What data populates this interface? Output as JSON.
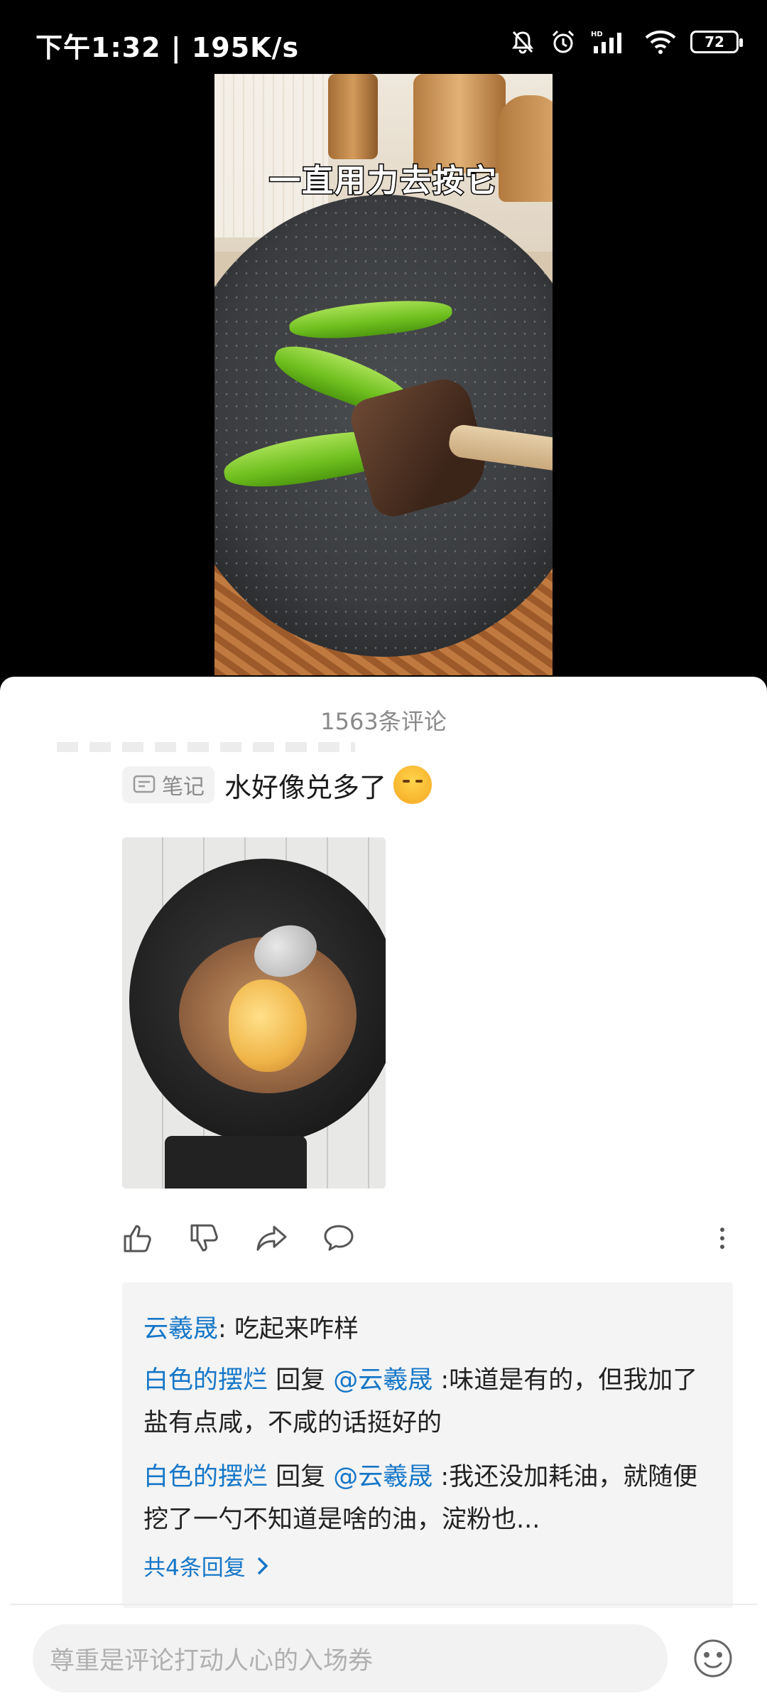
{
  "status_bar": {
    "time_speed": "下午1:32 | 195K/s",
    "battery": "72",
    "icons": [
      "mute-bell-icon",
      "alarm-icon",
      "hd-signal-icon",
      "wifi-icon",
      "battery-icon"
    ]
  },
  "video": {
    "caption": "一直用力去按它"
  },
  "comments": {
    "count_title": "1563条评论",
    "comment": {
      "note_tag": "笔记",
      "text": "水好像兑多了",
      "emoji": "blush-emoji"
    },
    "replies": [
      {
        "user": "云羲晟",
        "sep": ": ",
        "text": "吃起来咋样"
      },
      {
        "user": "白色的摆烂",
        "reply_word": " 回复 ",
        "target": "@云羲晟",
        "text": " :味道是有的，但我加了盐有点咸，不咸的话挺好的"
      },
      {
        "user": "白色的摆烂",
        "reply_word": " 回复 ",
        "target": "@云羲晟",
        "text": " :我还没加耗油，就随便挖了一勺不知道是啥的油，淀粉也..."
      }
    ],
    "more_replies": "共4条回复"
  },
  "input": {
    "placeholder": "尊重是评论打动人心的入场券"
  },
  "colors": {
    "link": "#1677c8",
    "sheet_bg": "#ffffff",
    "reply_bg": "#f4f4f4"
  }
}
